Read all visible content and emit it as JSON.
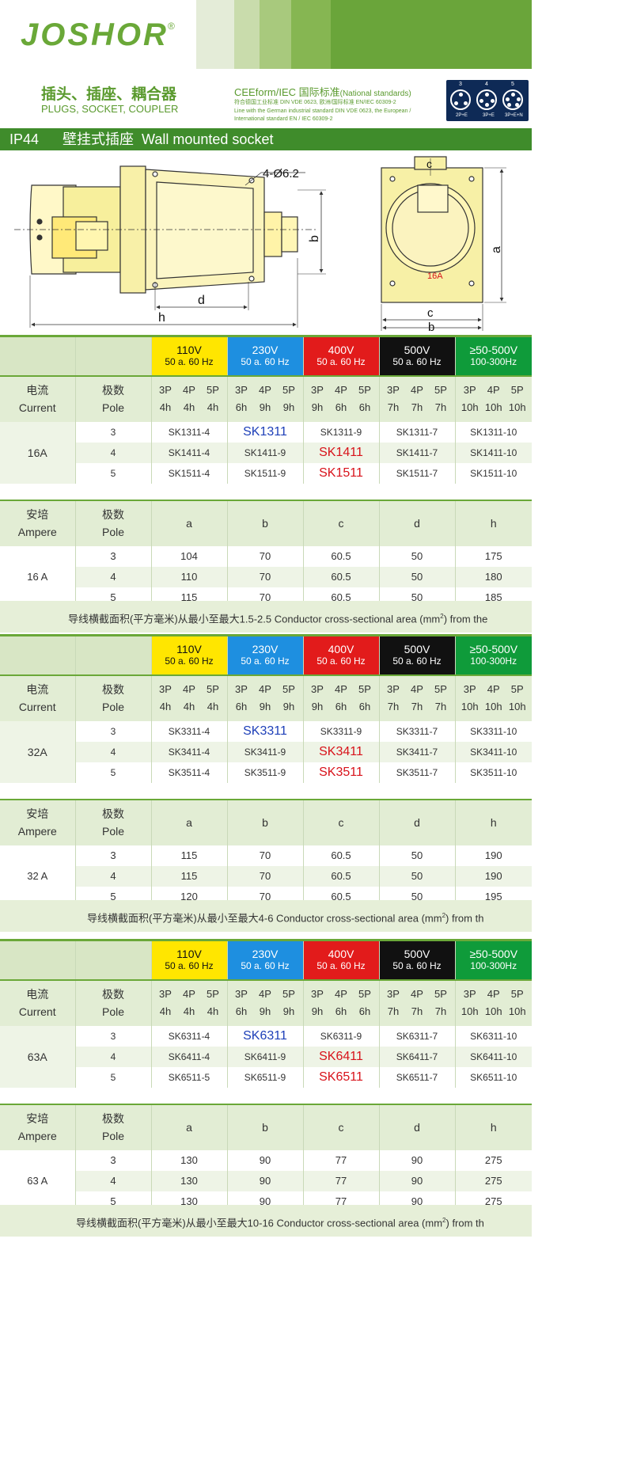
{
  "brand": {
    "logo": "JOSHOR",
    "reg": "®"
  },
  "product": {
    "title_cn": "插头、插座、耦合器",
    "title_en": "PLUGS, SOCKET, COUPLER"
  },
  "standards": {
    "title": "CEEform/IEC 国际标准",
    "title_small": "(National standards)",
    "line1": "符合德国工业标准 DIN VDE 0623, 欧洲/国际标准 EN/IEC 60309-2",
    "line2": "Line with the German industrial standard DIN VDE 0623, the European /",
    "line3": "International standard EN / IEC 60309-2"
  },
  "pin_diagrams": [
    {
      "num": "3",
      "label": "2P+E"
    },
    {
      "num": "4",
      "label": "3P+E"
    },
    {
      "num": "5",
      "label": "3P+E+N"
    }
  ],
  "section": {
    "ip": "IP44",
    "cn": "壁挂式插座",
    "en": "Wall mounted socket"
  },
  "drawing": {
    "hole_label": "4-Ø6.2",
    "dim_h": "h",
    "dim_d": "d",
    "dim_b_side": "b",
    "dim_a": "a",
    "dim_c": "c",
    "dim_b": "b",
    "dim_c_top": "c",
    "amp_mark": "16A"
  },
  "voltage_header": [
    {
      "v": "110V",
      "hz": "50 a. 60 Hz",
      "color": "#ffe600"
    },
    {
      "v": "230V",
      "hz": "50 a. 60 Hz",
      "color": "#1e8fe0"
    },
    {
      "v": "400V",
      "hz": "50 a. 60 Hz",
      "color": "#e21b1b"
    },
    {
      "v": "500V",
      "hz": "50 a. 60 Hz",
      "color": "#111111"
    },
    {
      "v": "≥50-500V",
      "hz": "100-300Hz",
      "color": "#0f9b3a"
    }
  ],
  "pole_header": {
    "current_cn": "电流",
    "current_en": "Current",
    "pole_cn": "极数",
    "pole_en": "Pole",
    "cols": [
      {
        "p": [
          "3P",
          "4P",
          "5P"
        ],
        "h": [
          "4h",
          "4h",
          "4h"
        ]
      },
      {
        "p": [
          "3P",
          "4P",
          "5P"
        ],
        "h": [
          "6h",
          "9h",
          "9h"
        ]
      },
      {
        "p": [
          "3P",
          "4P",
          "5P"
        ],
        "h": [
          "9h",
          "6h",
          "6h"
        ]
      },
      {
        "p": [
          "3P",
          "4P",
          "5P"
        ],
        "h": [
          "7h",
          "7h",
          "7h"
        ]
      },
      {
        "p": [
          "3P",
          "4P",
          "5P"
        ],
        "h": [
          "10h",
          "10h",
          "10h"
        ]
      }
    ]
  },
  "dim_header": {
    "amp_cn": "安培",
    "amp_en": "Ampere",
    "pole_cn": "极数",
    "pole_en": "Pole",
    "cols": [
      "a",
      "b",
      "c",
      "d",
      "h"
    ]
  },
  "groups": [
    {
      "current": "16A",
      "rows": [
        {
          "pole": "3",
          "codes": [
            "SK1311-4",
            "SK1311",
            "SK1311-9",
            "SK1311-7",
            "SK1311-10"
          ],
          "hl": [
            0,
            1,
            0,
            0,
            0
          ]
        },
        {
          "pole": "4",
          "codes": [
            "SK1411-4",
            "SK1411-9",
            "SK1411",
            "SK1411-7",
            "SK1411-10"
          ],
          "hl": [
            0,
            0,
            2,
            0,
            0
          ]
        },
        {
          "pole": "5",
          "codes": [
            "SK1511-4",
            "SK1511-9",
            "SK1511",
            "SK1511-7",
            "SK1511-10"
          ],
          "hl": [
            0,
            0,
            2,
            0,
            0
          ]
        }
      ],
      "ampere": "16 A",
      "dims": [
        {
          "pole": "3",
          "vals": [
            "104",
            "70",
            "60.5",
            "50",
            "175"
          ]
        },
        {
          "pole": "4",
          "vals": [
            "110",
            "70",
            "60.5",
            "50",
            "180"
          ]
        },
        {
          "pole": "5",
          "vals": [
            "115",
            "70",
            "60.5",
            "50",
            "185"
          ]
        }
      ],
      "footer_a": "导线横截面积(平方毫米)从最小至最大1.5-2.5    Conductor cross-sectional area (mm",
      "footer_b": ") from the"
    },
    {
      "current": "32A",
      "rows": [
        {
          "pole": "3",
          "codes": [
            "SK3311-4",
            "SK3311",
            "SK3311-9",
            "SK3311-7",
            "SK3311-10"
          ],
          "hl": [
            0,
            1,
            0,
            0,
            0
          ]
        },
        {
          "pole": "4",
          "codes": [
            "SK3411-4",
            "SK3411-9",
            "SK3411",
            "SK3411-7",
            "SK3411-10"
          ],
          "hl": [
            0,
            0,
            2,
            0,
            0
          ]
        },
        {
          "pole": "5",
          "codes": [
            "SK3511-4",
            "SK3511-9",
            "SK3511",
            "SK3511-7",
            "SK3511-10"
          ],
          "hl": [
            0,
            0,
            2,
            0,
            0
          ]
        }
      ],
      "ampere": "32 A",
      "dims": [
        {
          "pole": "3",
          "vals": [
            "115",
            "70",
            "60.5",
            "50",
            "190"
          ]
        },
        {
          "pole": "4",
          "vals": [
            "115",
            "70",
            "60.5",
            "50",
            "190"
          ]
        },
        {
          "pole": "5",
          "vals": [
            "120",
            "70",
            "60.5",
            "50",
            "195"
          ]
        }
      ],
      "footer_a": "导线横截面积(平方毫米)从最小至最大4-6    Conductor cross-sectional area (mm",
      "footer_b": ") from th"
    },
    {
      "current": "63A",
      "rows": [
        {
          "pole": "3",
          "codes": [
            "SK6311-4",
            "SK6311",
            "SK6311-9",
            "SK6311-7",
            "SK6311-10"
          ],
          "hl": [
            0,
            1,
            0,
            0,
            0
          ]
        },
        {
          "pole": "4",
          "codes": [
            "SK6411-4",
            "SK6411-9",
            "SK6411",
            "SK6411-7",
            "SK6411-10"
          ],
          "hl": [
            0,
            0,
            2,
            0,
            0
          ]
        },
        {
          "pole": "5",
          "codes": [
            "SK6511-5",
            "SK6511-9",
            "SK6511",
            "SK6511-7",
            "SK6511-10"
          ],
          "hl": [
            0,
            0,
            2,
            0,
            0
          ]
        }
      ],
      "ampere": "63 A",
      "dims": [
        {
          "pole": "3",
          "vals": [
            "130",
            "90",
            "77",
            "90",
            "275"
          ]
        },
        {
          "pole": "4",
          "vals": [
            "130",
            "90",
            "77",
            "90",
            "275"
          ]
        },
        {
          "pole": "5",
          "vals": [
            "130",
            "90",
            "77",
            "90",
            "275"
          ]
        }
      ],
      "footer_a": "导线横截面积(平方毫米)从最小至最大10-16    Conductor cross-sectional area (mm",
      "footer_b": ") from th"
    }
  ],
  "sup2": "2"
}
